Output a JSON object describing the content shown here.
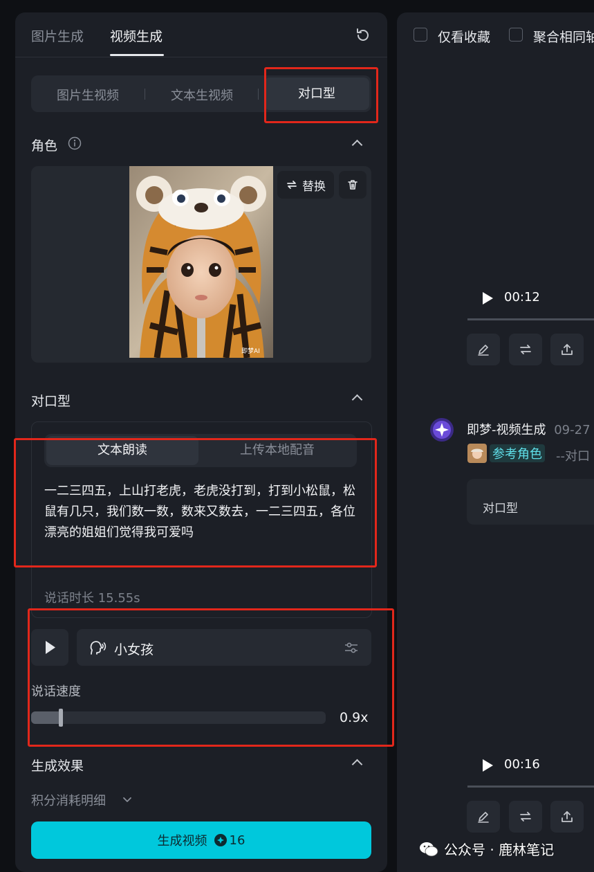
{
  "left": {
    "top_tabs": [
      "图片生成",
      "视频生成"
    ],
    "segments": [
      "图片生视频",
      "文本生视频",
      "对口型"
    ],
    "role_section": {
      "title": "角色",
      "replace_label": "替换",
      "photo_watermark": "即梦AI"
    },
    "lipsync_section": {
      "title": "对口型",
      "subtabs": [
        "文本朗读",
        "上传本地配音"
      ],
      "text": "一二三四五，上山打老虎，老虎没打到，打到小松鼠，松鼠有几只，我们数一数，数来又数去，一二三四五，各位漂亮的姐姐们觉得我可爱吗",
      "duration": "说话时长 15.55s",
      "voice_name": "小女孩",
      "speed_label": "说话速度",
      "speed_value": "0.9x",
      "speed_fraction": 0.1
    },
    "effect_section": {
      "title": "生成效果",
      "points_detail": "积分消耗明细"
    },
    "generate": {
      "label": "生成视频",
      "cost": "16"
    }
  },
  "right": {
    "filters": [
      "仅看收藏",
      "聚合相同轴"
    ],
    "video1_time": "00:12",
    "message": {
      "sender": "即梦-视频生成",
      "date": "09-27",
      "ref_chip": "参考角色",
      "ref_tail": "--对口",
      "bubble_text": "对口型"
    },
    "video2_time": "00:16"
  },
  "watermark": "公众号 · 鹿林笔记",
  "colors": {
    "accent": "#00c8dc",
    "highlight": "#e2271b",
    "panel": "#1c1f26",
    "background": "#0e1014"
  }
}
